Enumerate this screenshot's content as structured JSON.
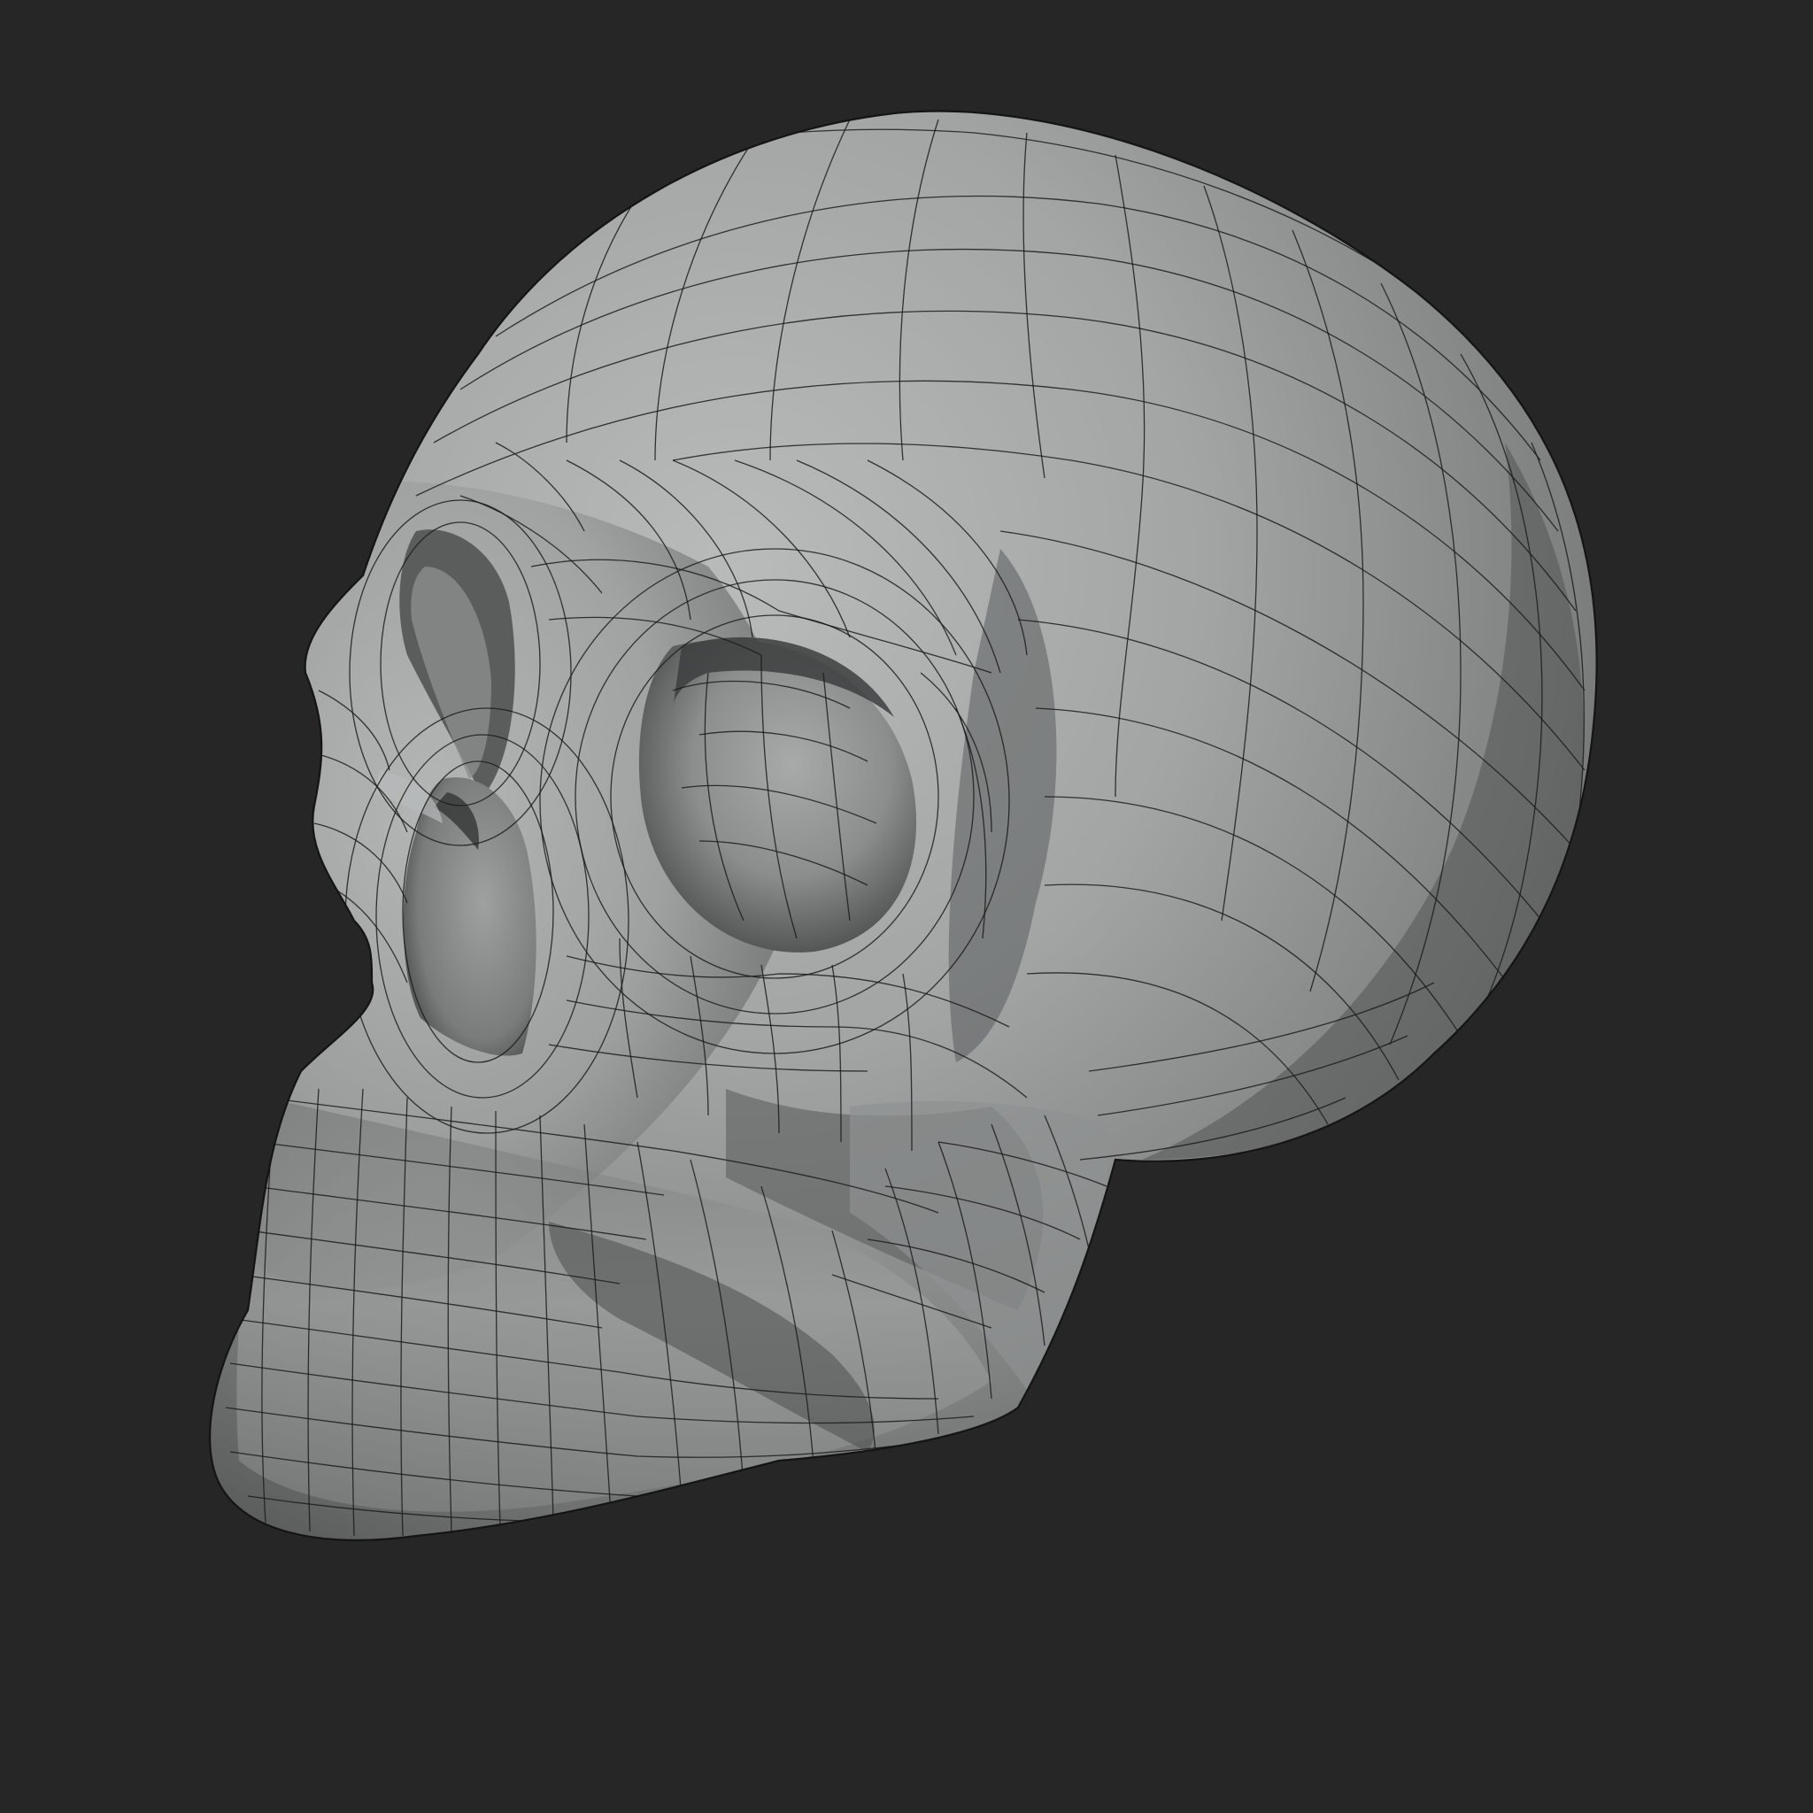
{
  "scene": {
    "background_color": "#262626",
    "material_color": "#9a9c9c",
    "wire_color": "#1a1a1a",
    "subject": "skull-model",
    "shading": "clay-matcap",
    "wireframe_overlay": true
  }
}
